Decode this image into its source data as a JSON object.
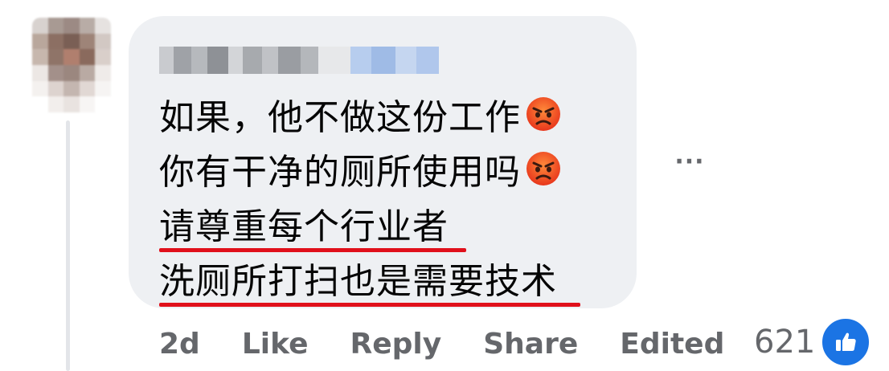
{
  "comment": {
    "lines": [
      "如果，他不做这份工作",
      "你有干净的厕所使用吗",
      "请尊重每个行业者",
      "洗厕所打扫也是需要技术"
    ],
    "emoji": "pouting-face"
  },
  "meta": {
    "timestamp": "2d",
    "like_label": "Like",
    "reply_label": "Reply",
    "share_label": "Share",
    "edited_label": "Edited",
    "reaction_count": "621",
    "more_label": "···"
  },
  "colors": {
    "bubble": "#eef0f3",
    "text": "#050505",
    "muted": "#65676b",
    "underline": "#e0101b",
    "like_blue": "#1b74e4"
  },
  "icons": [
    "avatar",
    "pouting-face-emoji",
    "like-thumb-icon",
    "more-options-icon"
  ]
}
